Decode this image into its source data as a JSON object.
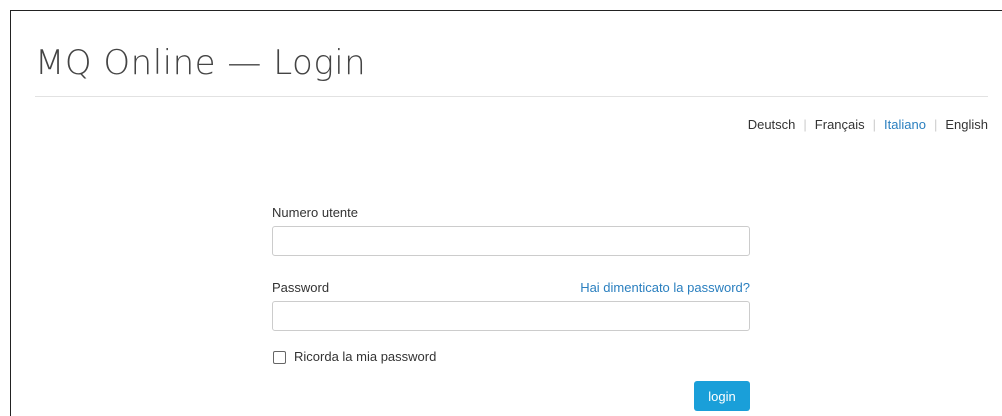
{
  "header": {
    "title": "MQ Online — Login"
  },
  "languages": [
    {
      "label": "Deutsch",
      "active": false
    },
    {
      "label": "Français",
      "active": false
    },
    {
      "label": "Italiano",
      "active": true
    },
    {
      "label": "English",
      "active": false
    }
  ],
  "form": {
    "username_label": "Numero utente",
    "username_value": "",
    "password_label": "Password",
    "password_value": "",
    "forgot_password": "Hai dimenticato la password?",
    "remember_label": "Ricorda la mia password",
    "remember_checked": false,
    "login_button": "login"
  },
  "colors": {
    "accent": "#1a9fd9",
    "link": "#2a7fbf"
  }
}
